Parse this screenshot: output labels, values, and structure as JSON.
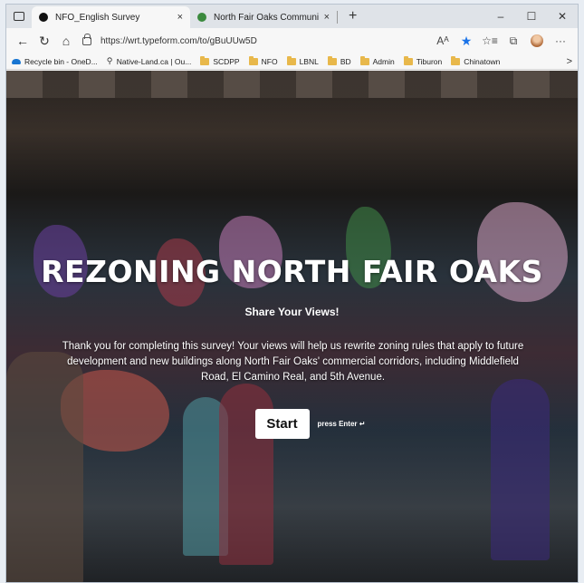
{
  "tabs": [
    {
      "title": "NFO_English Survey",
      "active": true,
      "favicon_color": "#111111"
    },
    {
      "title": "North Fair Oaks Community Plan",
      "active": false,
      "favicon_color": "#3b8a3e"
    }
  ],
  "tab_icons": {
    "actions": "tab-actions-icon",
    "close": "×",
    "new_tab": "+"
  },
  "window_controls": {
    "minimize": "–",
    "maximize": "☐",
    "close": "✕"
  },
  "nav": {
    "back": "←",
    "refresh": "↻",
    "home": "⌂"
  },
  "address": {
    "url": "https://wrt.typeform.com/to/gBuUUw5D"
  },
  "toolbar": {
    "read_aloud": "Aᴬ",
    "favorite": "★",
    "collections": "☆≡",
    "wallet": "⧉",
    "more": "···",
    "accent": "#1a73e8"
  },
  "bookmarks": [
    {
      "label": "Recycle bin - OneD...",
      "icon": "cloud-icon"
    },
    {
      "label": "Native-Land.ca | Ou...",
      "icon": "pin-icon"
    },
    {
      "label": "SCDPP",
      "icon": "folder-icon"
    },
    {
      "label": "NFO",
      "icon": "folder-icon"
    },
    {
      "label": "LBNL",
      "icon": "folder-icon"
    },
    {
      "label": "BD",
      "icon": "folder-icon"
    },
    {
      "label": "Admin",
      "icon": "folder-icon"
    },
    {
      "label": "Tiburon",
      "icon": "folder-icon"
    },
    {
      "label": "Chinatown",
      "icon": "folder-icon"
    }
  ],
  "bookmarks_more": ">",
  "hero": {
    "title": "REZONING NORTH FAIR OAKS",
    "subtitle": "Share Your Views!",
    "body": "Thank you for completing this survey! Your views will help us rewrite zoning rules that apply to future development and new buildings along North Fair Oaks' commercial corridors, including Middlefield Road, El Camino Real, and 5th Avenue.",
    "start_label": "Start",
    "enter_hint": "press Enter ↵"
  }
}
